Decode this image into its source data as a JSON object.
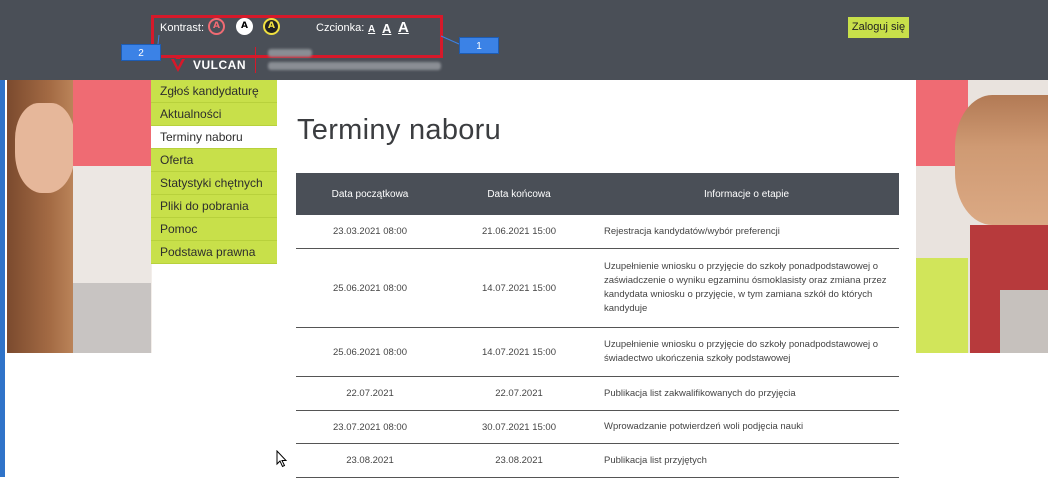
{
  "toolbar": {
    "contrast_label": "Kontrast:",
    "contrast_buttons": [
      "A",
      "A",
      "A"
    ],
    "font_label": "Czcionka:",
    "font_buttons": [
      "A",
      "A",
      "A"
    ],
    "login_label": "Zaloguj się"
  },
  "callouts": [
    "1",
    "2"
  ],
  "brand": {
    "logo_text": "VULCAN"
  },
  "colors": {
    "accent_green": "#c8e04a",
    "header_bg": "#4a4f57",
    "brand_red": "#d6192a",
    "callout_blue": "#3b82e6"
  },
  "nav": {
    "items": [
      {
        "label": "Zgłoś kandydaturę"
      },
      {
        "label": "Aktualności"
      },
      {
        "label": "Terminy naboru"
      },
      {
        "label": "Oferta"
      },
      {
        "label": "Statystyki chętnych"
      },
      {
        "label": "Pliki do pobrania"
      },
      {
        "label": "Pomoc"
      },
      {
        "label": "Podstawa prawna"
      }
    ],
    "active": "Terminy naboru"
  },
  "main": {
    "title": "Terminy naboru",
    "table": {
      "headers": [
        "Data początkowa",
        "Data końcowa",
        "Informacje o etapie"
      ],
      "rows": [
        [
          "23.03.2021 08:00",
          "21.06.2021 15:00",
          "Rejestracja kandydatów/wybór preferencji"
        ],
        [
          "25.06.2021 08:00",
          "14.07.2021 15:00",
          "Uzupełnienie wniosku o przyjęcie do szkoły ponadpodstawowej o zaświadczenie o wyniku egzaminu ósmoklasisty oraz zmiana przez kandydata wniosku o przyjęcie, w tym zamiana szkół do których kandyduje"
        ],
        [
          "25.06.2021 08:00",
          "14.07.2021 15:00",
          "Uzupełnienie wniosku o przyjęcie do szkoły ponadpodstawowej o świadectwo ukończenia szkoły podstawowej"
        ],
        [
          "22.07.2021",
          "22.07.2021",
          "Publikacja list zakwalifikowanych do przyjęcia"
        ],
        [
          "23.07.2021 08:00",
          "30.07.2021 15:00",
          "Wprowadzanie potwierdzeń woli podjęcia nauki"
        ],
        [
          "23.08.2021",
          "23.08.2021",
          "Publikacja list przyjętych"
        ]
      ]
    }
  }
}
